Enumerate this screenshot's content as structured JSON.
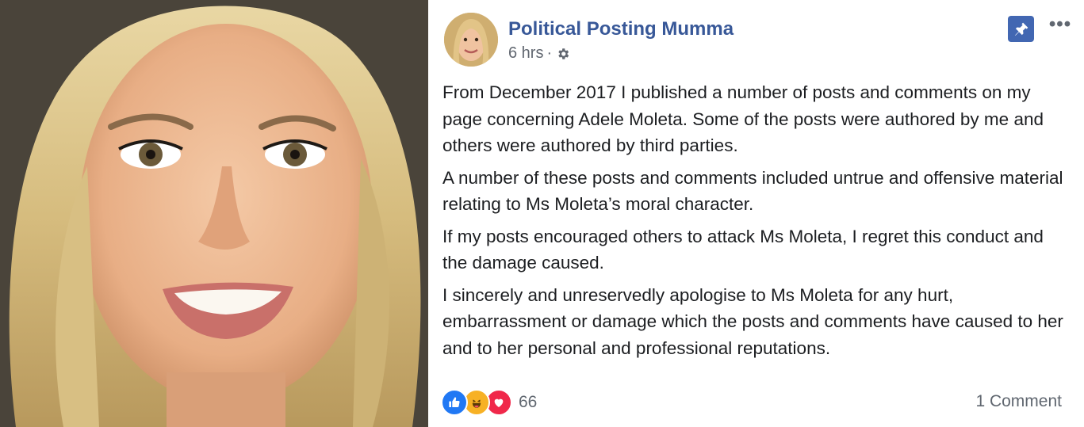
{
  "post": {
    "author": "Political Posting Mumma",
    "time": "6 hrs",
    "separator": "·",
    "paragraphs": [
      "From December 2017 I published a number of posts and comments on my page concerning Adele Moleta. Some of the posts were authored by me and others were authored by third parties.",
      "A number of these posts and comments included untrue and offensive material relating to Ms Moleta’s moral character.",
      "If my posts encouraged others to attack Ms Moleta, I regret this conduct and the damage caused.",
      "I sincerely and unreservedly apologise to Ms Moleta for any hurt, embarrassment or damage which the posts and comments have caused to her and to her personal and professional reputations."
    ],
    "reaction_count": "66",
    "comment_count_label": "1 Comment"
  },
  "icons": {
    "visibility": "gear-icon",
    "pin": "pin-icon",
    "more": "more-options-icon",
    "reactions": [
      "like-reaction-icon",
      "haha-reaction-icon",
      "love-reaction-icon"
    ]
  },
  "colors": {
    "author_link": "#385898",
    "pin_bg": "#4267b2",
    "like": "#2078f4",
    "haha": "#f7b125",
    "love": "#f0284a",
    "meta_text": "#616770"
  }
}
